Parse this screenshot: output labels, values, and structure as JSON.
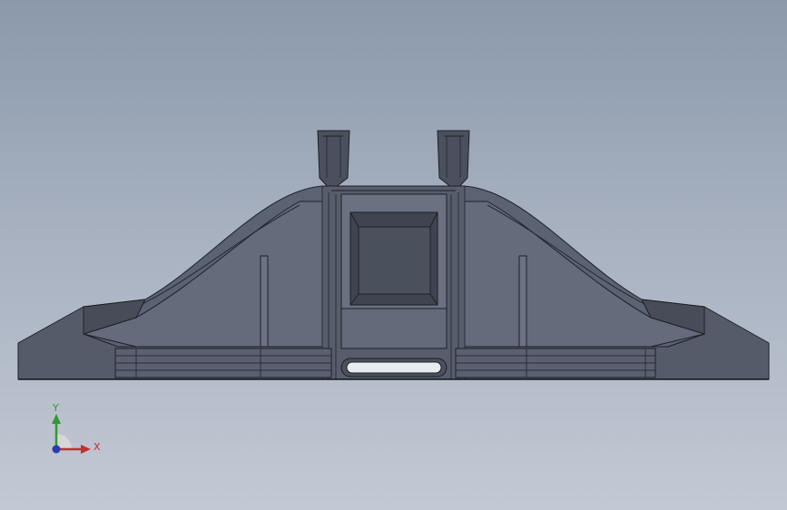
{
  "viewport": {
    "colors": {
      "background_top": "#8b99ab",
      "background_bottom": "#c3c9d4",
      "part_fill": "#4f5563",
      "part_shade": "#5d6474",
      "part_dark": "#3d424e",
      "edge": "#1d2028",
      "slot_highlight": "#e8ebf0"
    }
  },
  "triad": {
    "y_label": "Y",
    "x_label": "X",
    "colors": {
      "x": "#c03030",
      "y": "#2f9a2f",
      "z": "#2c3bb0"
    }
  }
}
